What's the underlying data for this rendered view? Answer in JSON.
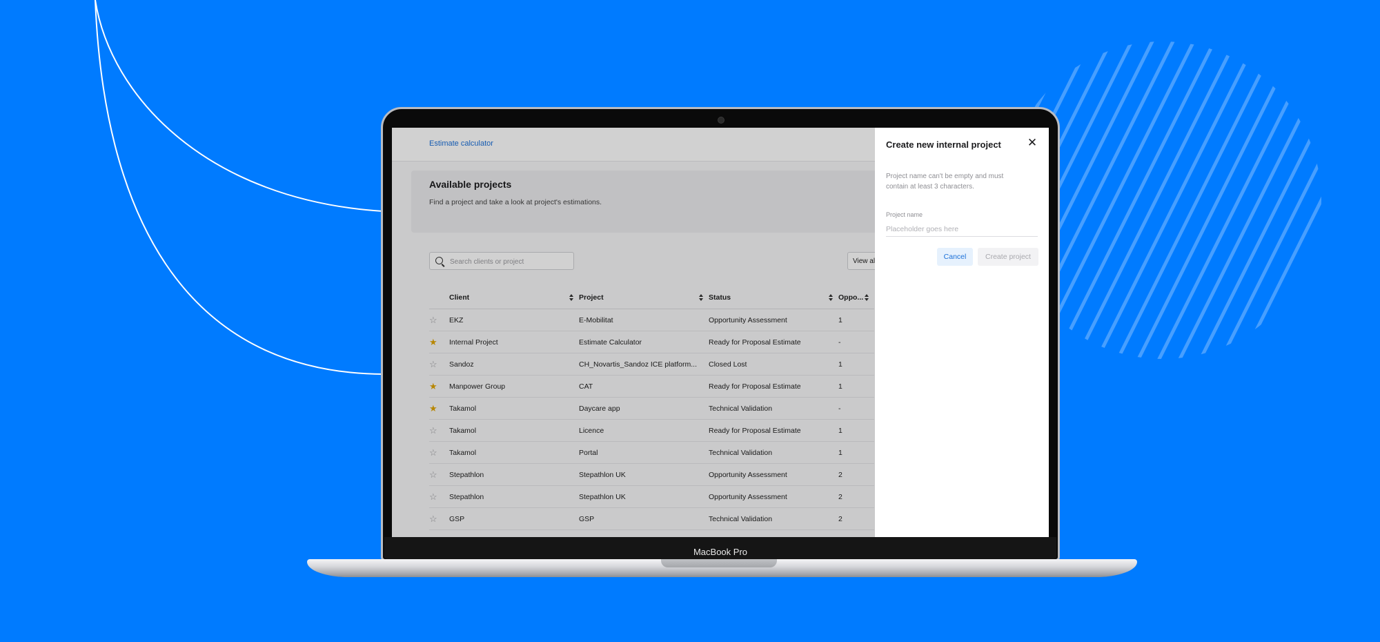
{
  "device": {
    "brand_label": "MacBook Pro"
  },
  "app": {
    "breadcrumb": "Estimate calculator",
    "hero": {
      "title": "Available projects",
      "subtitle": "Find a project and take a look at project's estimations."
    },
    "search": {
      "placeholder": "Search clients or project",
      "value": ""
    },
    "view_all_label": "View al",
    "table": {
      "columns": [
        "Client",
        "Project",
        "Status",
        "Oppo..."
      ],
      "rows": [
        {
          "starred": false,
          "client": "EKZ",
          "project": "E-Mobilitat",
          "status": "Opportunity Assessment",
          "opp": "1"
        },
        {
          "starred": true,
          "client": "Internal Project",
          "project": "Estimate Calculator",
          "status": "Ready for Proposal Estimate",
          "opp": "-"
        },
        {
          "starred": false,
          "client": "Sandoz",
          "project": "CH_Novartis_Sandoz ICE platform...",
          "status": "Closed Lost",
          "opp": "1"
        },
        {
          "starred": true,
          "client": "Manpower Group",
          "project": "CAT",
          "status": "Ready for Proposal Estimate",
          "opp": "1"
        },
        {
          "starred": true,
          "client": "Takamol",
          "project": "Daycare app",
          "status": "Technical Validation",
          "opp": "-"
        },
        {
          "starred": false,
          "client": "Takamol",
          "project": "Licence",
          "status": "Ready for Proposal Estimate",
          "opp": "1"
        },
        {
          "starred": false,
          "client": "Takamol",
          "project": "Portal",
          "status": "Technical Validation",
          "opp": "1"
        },
        {
          "starred": false,
          "client": "Stepathlon",
          "project": "Stepathlon UK",
          "status": "Opportunity Assessment",
          "opp": "2"
        },
        {
          "starred": false,
          "client": "Stepathlon",
          "project": "Stepathlon UK",
          "status": "Opportunity Assessment",
          "opp": "2"
        },
        {
          "starred": false,
          "client": "GSP",
          "project": "GSP",
          "status": "Technical Validation",
          "opp": "2"
        }
      ]
    }
  },
  "panel": {
    "title": "Create new internal project",
    "close_icon": "close-icon",
    "hint": "Project name can't be empty and must contain at least 3 characters.",
    "field_label": "Project name",
    "field_placeholder": "Placeholder goes here",
    "field_value": "",
    "cancel_label": "Cancel",
    "create_label": "Create project"
  },
  "colors": {
    "background": "#007bff",
    "accent": "#1a6fd8",
    "star_on": "#e0a400"
  }
}
